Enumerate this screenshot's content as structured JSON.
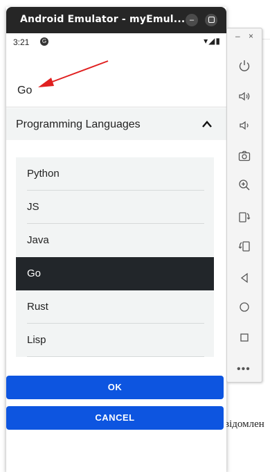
{
  "window": {
    "title": "Android Emulator - myEmul..."
  },
  "status_bar": {
    "time": "3:21",
    "notification_glyph": "G",
    "icons": "▾◢▮"
  },
  "selected_value": "Go",
  "accordion": {
    "title": "Programming Languages",
    "expanded": true
  },
  "options": [
    "Python",
    "JS",
    "Java",
    "Go",
    "Rust",
    "Lisp"
  ],
  "selected_option": "Go",
  "buttons": {
    "ok": "OK",
    "cancel": "CANCEL"
  },
  "toolbar": {
    "minimize": "–",
    "close": "×",
    "more": "•••",
    "icons": [
      "power-icon",
      "volume-up-icon",
      "volume-down-icon",
      "camera-icon",
      "zoom-icon",
      "rotate-left-icon",
      "rotate-right-icon",
      "back-icon",
      "home-icon",
      "overview-icon"
    ]
  },
  "background": {
    "frag_top": "*= *=",
    "frag_mid": "(",
    "frag_bottom": "відомлен"
  },
  "colors": {
    "accent": "#0d55e0",
    "selected_bg": "#22262a",
    "panel_bg": "#f2f4f4",
    "annotation_arrow": "#e02020"
  }
}
